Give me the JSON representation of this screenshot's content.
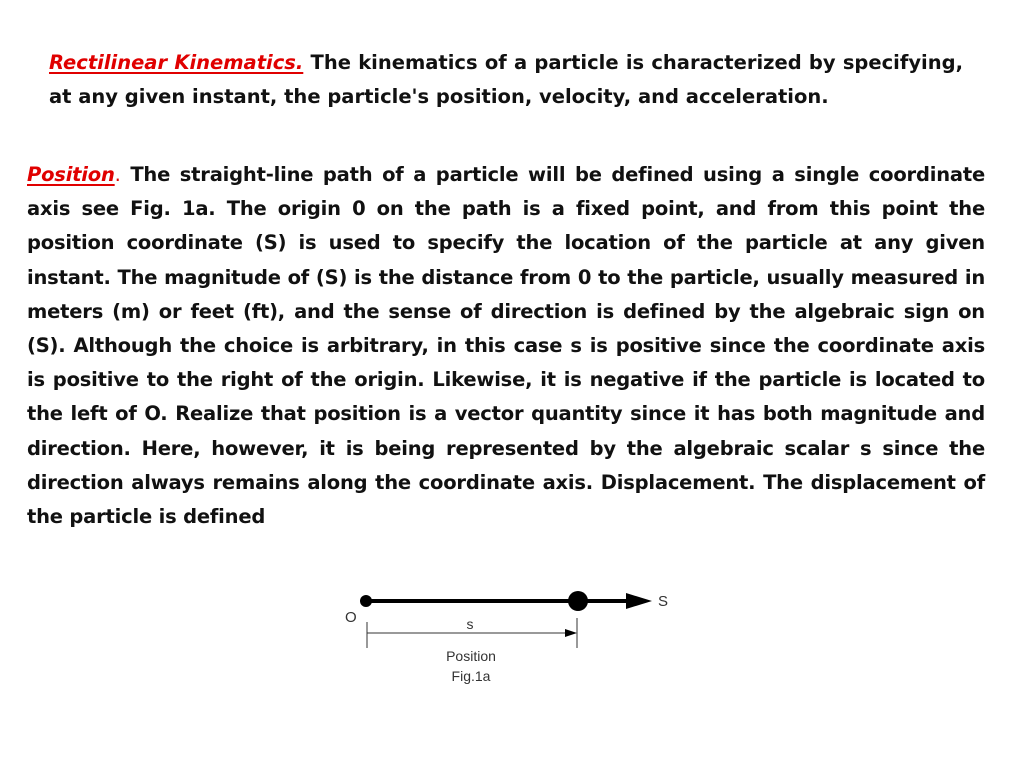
{
  "intro": {
    "heading": "Rectilinear  Kinematics.",
    "text": " The kinematics of a particle is characterized by specifying, at any given instant, the particle's position, velocity, and acceleration."
  },
  "position": {
    "heading": "Position",
    "dot": ".",
    "text": " The straight-line path of a particle will be defined using a single coordinate axis see Fig. 1a. The origin 0 on the path is a fixed point, and from this point the position coordinate (S) is used to specify the location of the particle at any given instant. The magnitude of (S) is the distance from 0 to the particle, usually measured in meters (m) or feet (ft), and the sense of direction is defined by the algebraic sign on (S). Although the choice is arbitrary, in this case s is positive since the coordinate axis is positive to the right of the origin. Likewise, it is negative if the particle is located to the left of O. Realize that position is a vector quantity since it has both magnitude and direction. Here, however, it is being represented by the algebraic scalar s since the direction always remains along the coordinate axis. Displacement. The displacement of the particle is defined"
  },
  "figure": {
    "origin_label": "O",
    "axis_label": "S",
    "distance_label": "s",
    "caption_line1": "Position",
    "caption_line2": "Fig.1a"
  }
}
